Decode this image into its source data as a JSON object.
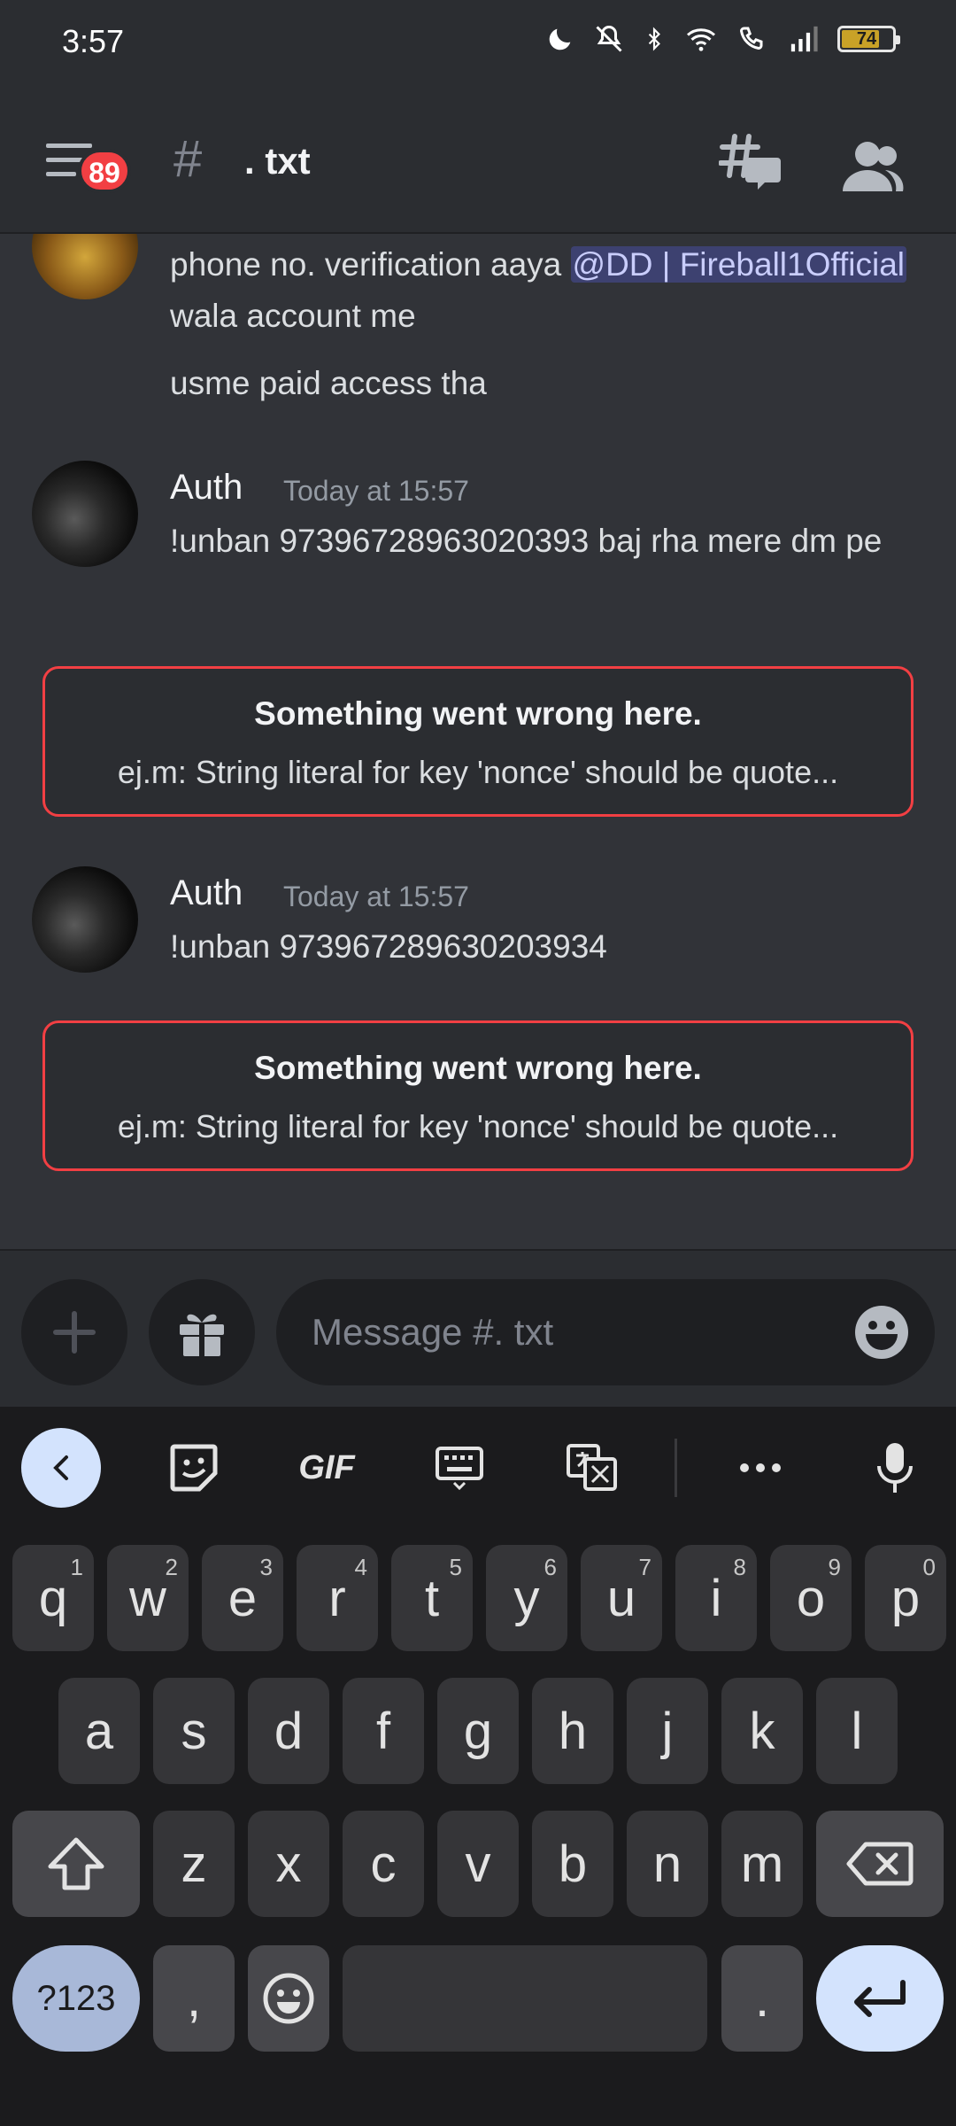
{
  "status_bar": {
    "time": "3:57",
    "battery": "74"
  },
  "header": {
    "unread_count": "89",
    "hash_symbol": "#",
    "channel_name": ". txt"
  },
  "messages": {
    "first": {
      "line1_before": "phone no. verification aaya ",
      "mention": "@DD | Fireball1Official",
      "line1_after": " wala account me",
      "line2": "usme paid access tha"
    },
    "second": {
      "author": "Auth",
      "timestamp": "Today at 15:57",
      "text": "!unban 97396728963020393 baj rha mere dm pe"
    },
    "error1": {
      "title": "Something went wrong here.",
      "desc": "ej.m: String literal for key 'nonce' should be quote..."
    },
    "third": {
      "author": "Auth",
      "timestamp": "Today at 15:57",
      "text": "!unban 973967289630203934"
    },
    "error2": {
      "title": "Something went wrong here.",
      "desc": "ej.m: String literal for key 'nonce' should be quote..."
    }
  },
  "composer": {
    "placeholder": "Message #. txt"
  },
  "keyboard": {
    "toolbar_gif": "GIF",
    "row1": [
      {
        "k": "q",
        "n": "1"
      },
      {
        "k": "w",
        "n": "2"
      },
      {
        "k": "e",
        "n": "3"
      },
      {
        "k": "r",
        "n": "4"
      },
      {
        "k": "t",
        "n": "5"
      },
      {
        "k": "y",
        "n": "6"
      },
      {
        "k": "u",
        "n": "7"
      },
      {
        "k": "i",
        "n": "8"
      },
      {
        "k": "o",
        "n": "9"
      },
      {
        "k": "p",
        "n": "0"
      }
    ],
    "row2": [
      "a",
      "s",
      "d",
      "f",
      "g",
      "h",
      "j",
      "k",
      "l"
    ],
    "row3": [
      "z",
      "x",
      "c",
      "v",
      "b",
      "n",
      "m"
    ],
    "sym_key": "?123",
    "comma_key": ",",
    "period_key": "."
  },
  "colors": {
    "background": "#313338",
    "header": "#2b2d31",
    "error_border": "#f23f43",
    "mention_bg": "#5865f2",
    "badge": "#f23f43"
  }
}
